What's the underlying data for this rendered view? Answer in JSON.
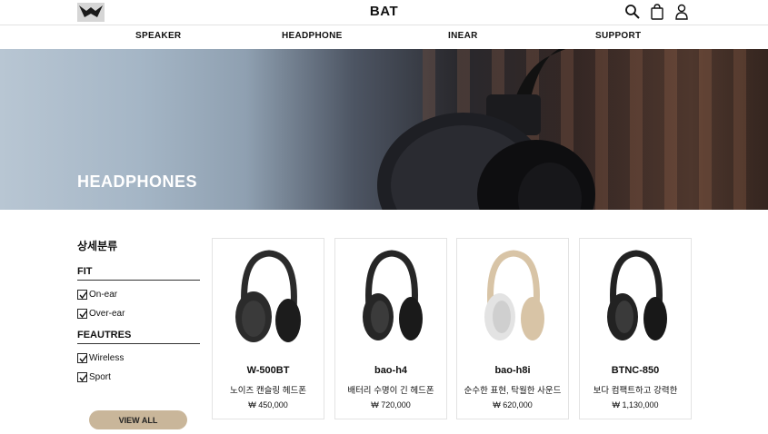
{
  "header": {
    "brand": "BAT",
    "icons": [
      "logo-icon",
      "search-icon",
      "bag-icon",
      "user-icon"
    ]
  },
  "nav": {
    "items": [
      {
        "label": "SPEAKER"
      },
      {
        "label": "HEADPHONE"
      },
      {
        "label": "INEAR"
      },
      {
        "label": "SUPPORT"
      }
    ]
  },
  "hero": {
    "title": "HEADPHONES"
  },
  "sidebar": {
    "title": "상세분류",
    "groups": [
      {
        "title": "FIT",
        "options": [
          {
            "label": "On-ear",
            "checked": true
          },
          {
            "label": "Over-ear",
            "checked": true
          }
        ]
      },
      {
        "title": "FEAUTRES",
        "options": [
          {
            "label": "Wireless",
            "checked": true
          },
          {
            "label": "Sport",
            "checked": true
          }
        ]
      }
    ],
    "view_all": "VIEW ALL"
  },
  "products": [
    {
      "name": "W-500BT",
      "desc": "노이즈 캔슬링 헤드폰",
      "price": "₩ 450,000",
      "color": "#2b2b2b"
    },
    {
      "name": "bao-h4",
      "desc": "배터리 수명이 긴 헤드폰",
      "price": "₩ 720,000",
      "color": "#262626"
    },
    {
      "name": "bao-h8i",
      "desc": "순수한 표현, 탁월한 사운드",
      "price": "₩ 620,000",
      "color": "#d8c4a6"
    },
    {
      "name": "BTNC-850",
      "desc": "보다 컴팩트하고 강력한",
      "price": "₩ 1,130,000",
      "color": "#222222"
    }
  ],
  "colors": {
    "accent": "#c9b69a",
    "hero_dark": "#2c2d33"
  }
}
